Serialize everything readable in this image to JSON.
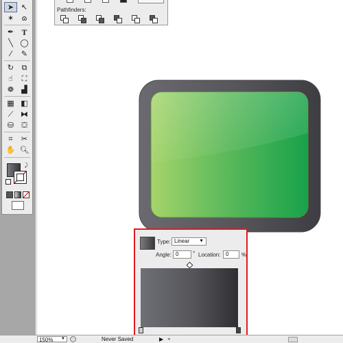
{
  "pathfinders_panel": {
    "label": "Pathfinders:"
  },
  "gradient_panel": {
    "type_label": "Type:",
    "type_value": "Linear",
    "angle_label": "Angle:",
    "angle_value": "0",
    "location_label": "Location:",
    "location_value": "0",
    "location_unit": "%"
  },
  "status_bar": {
    "zoom_value": "150%",
    "status_text": "Never Saved"
  },
  "colors": {
    "highlight_border": "#e01a22",
    "screen_green_light": "#a6d46a",
    "screen_green_dark": "#18a24a",
    "bezel_gray": "#58585d"
  },
  "icons": [
    "selection-tool",
    "direct-selection-tool",
    "magic-wand-tool",
    "lasso-tool",
    "pen-tool",
    "type-tool",
    "line-tool",
    "ellipse-tool",
    "paintbrush-tool",
    "pencil-tool",
    "rotate-tool",
    "scale-tool",
    "warp-tool",
    "free-transform-tool",
    "symbol-sprayer-tool",
    "graph-tool",
    "mesh-tool",
    "gradient-tool",
    "eyedropper-tool",
    "blend-tool",
    "live-paint-bucket-tool",
    "live-paint-selection-tool",
    "slice-tool",
    "eraser-tool",
    "hand-tool",
    "zoom-tool"
  ]
}
